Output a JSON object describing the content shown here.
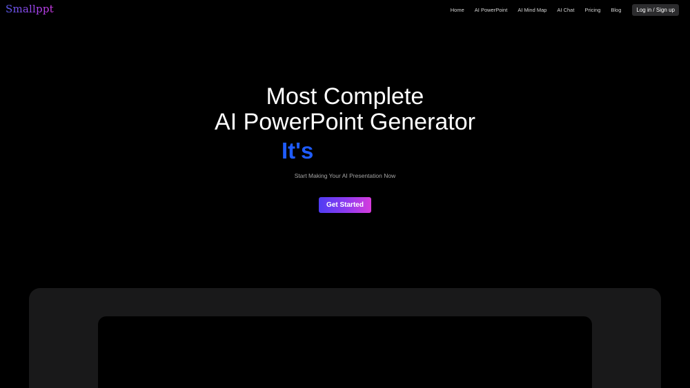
{
  "header": {
    "logo": "Smallppt",
    "nav": {
      "home": "Home",
      "ai_powerpoint": "AI PowerPoint",
      "ai_mind_map": "AI Mind Map",
      "ai_chat": "AI Chat",
      "pricing": "Pricing",
      "blog": "Blog"
    },
    "login_label": "Log in / Sign up"
  },
  "hero": {
    "title_line1": "Most Complete",
    "title_line2": "AI PowerPoint Generator",
    "typing_text": "It's",
    "subtitle": "Start Making Your AI Presentation Now",
    "cta_label": "Get Started"
  },
  "colors": {
    "background": "#000000",
    "accent_blue": "#1f5cff",
    "gradient_start": "#4f3cf3",
    "gradient_end": "#d63cdc",
    "panel": "#19191a"
  }
}
